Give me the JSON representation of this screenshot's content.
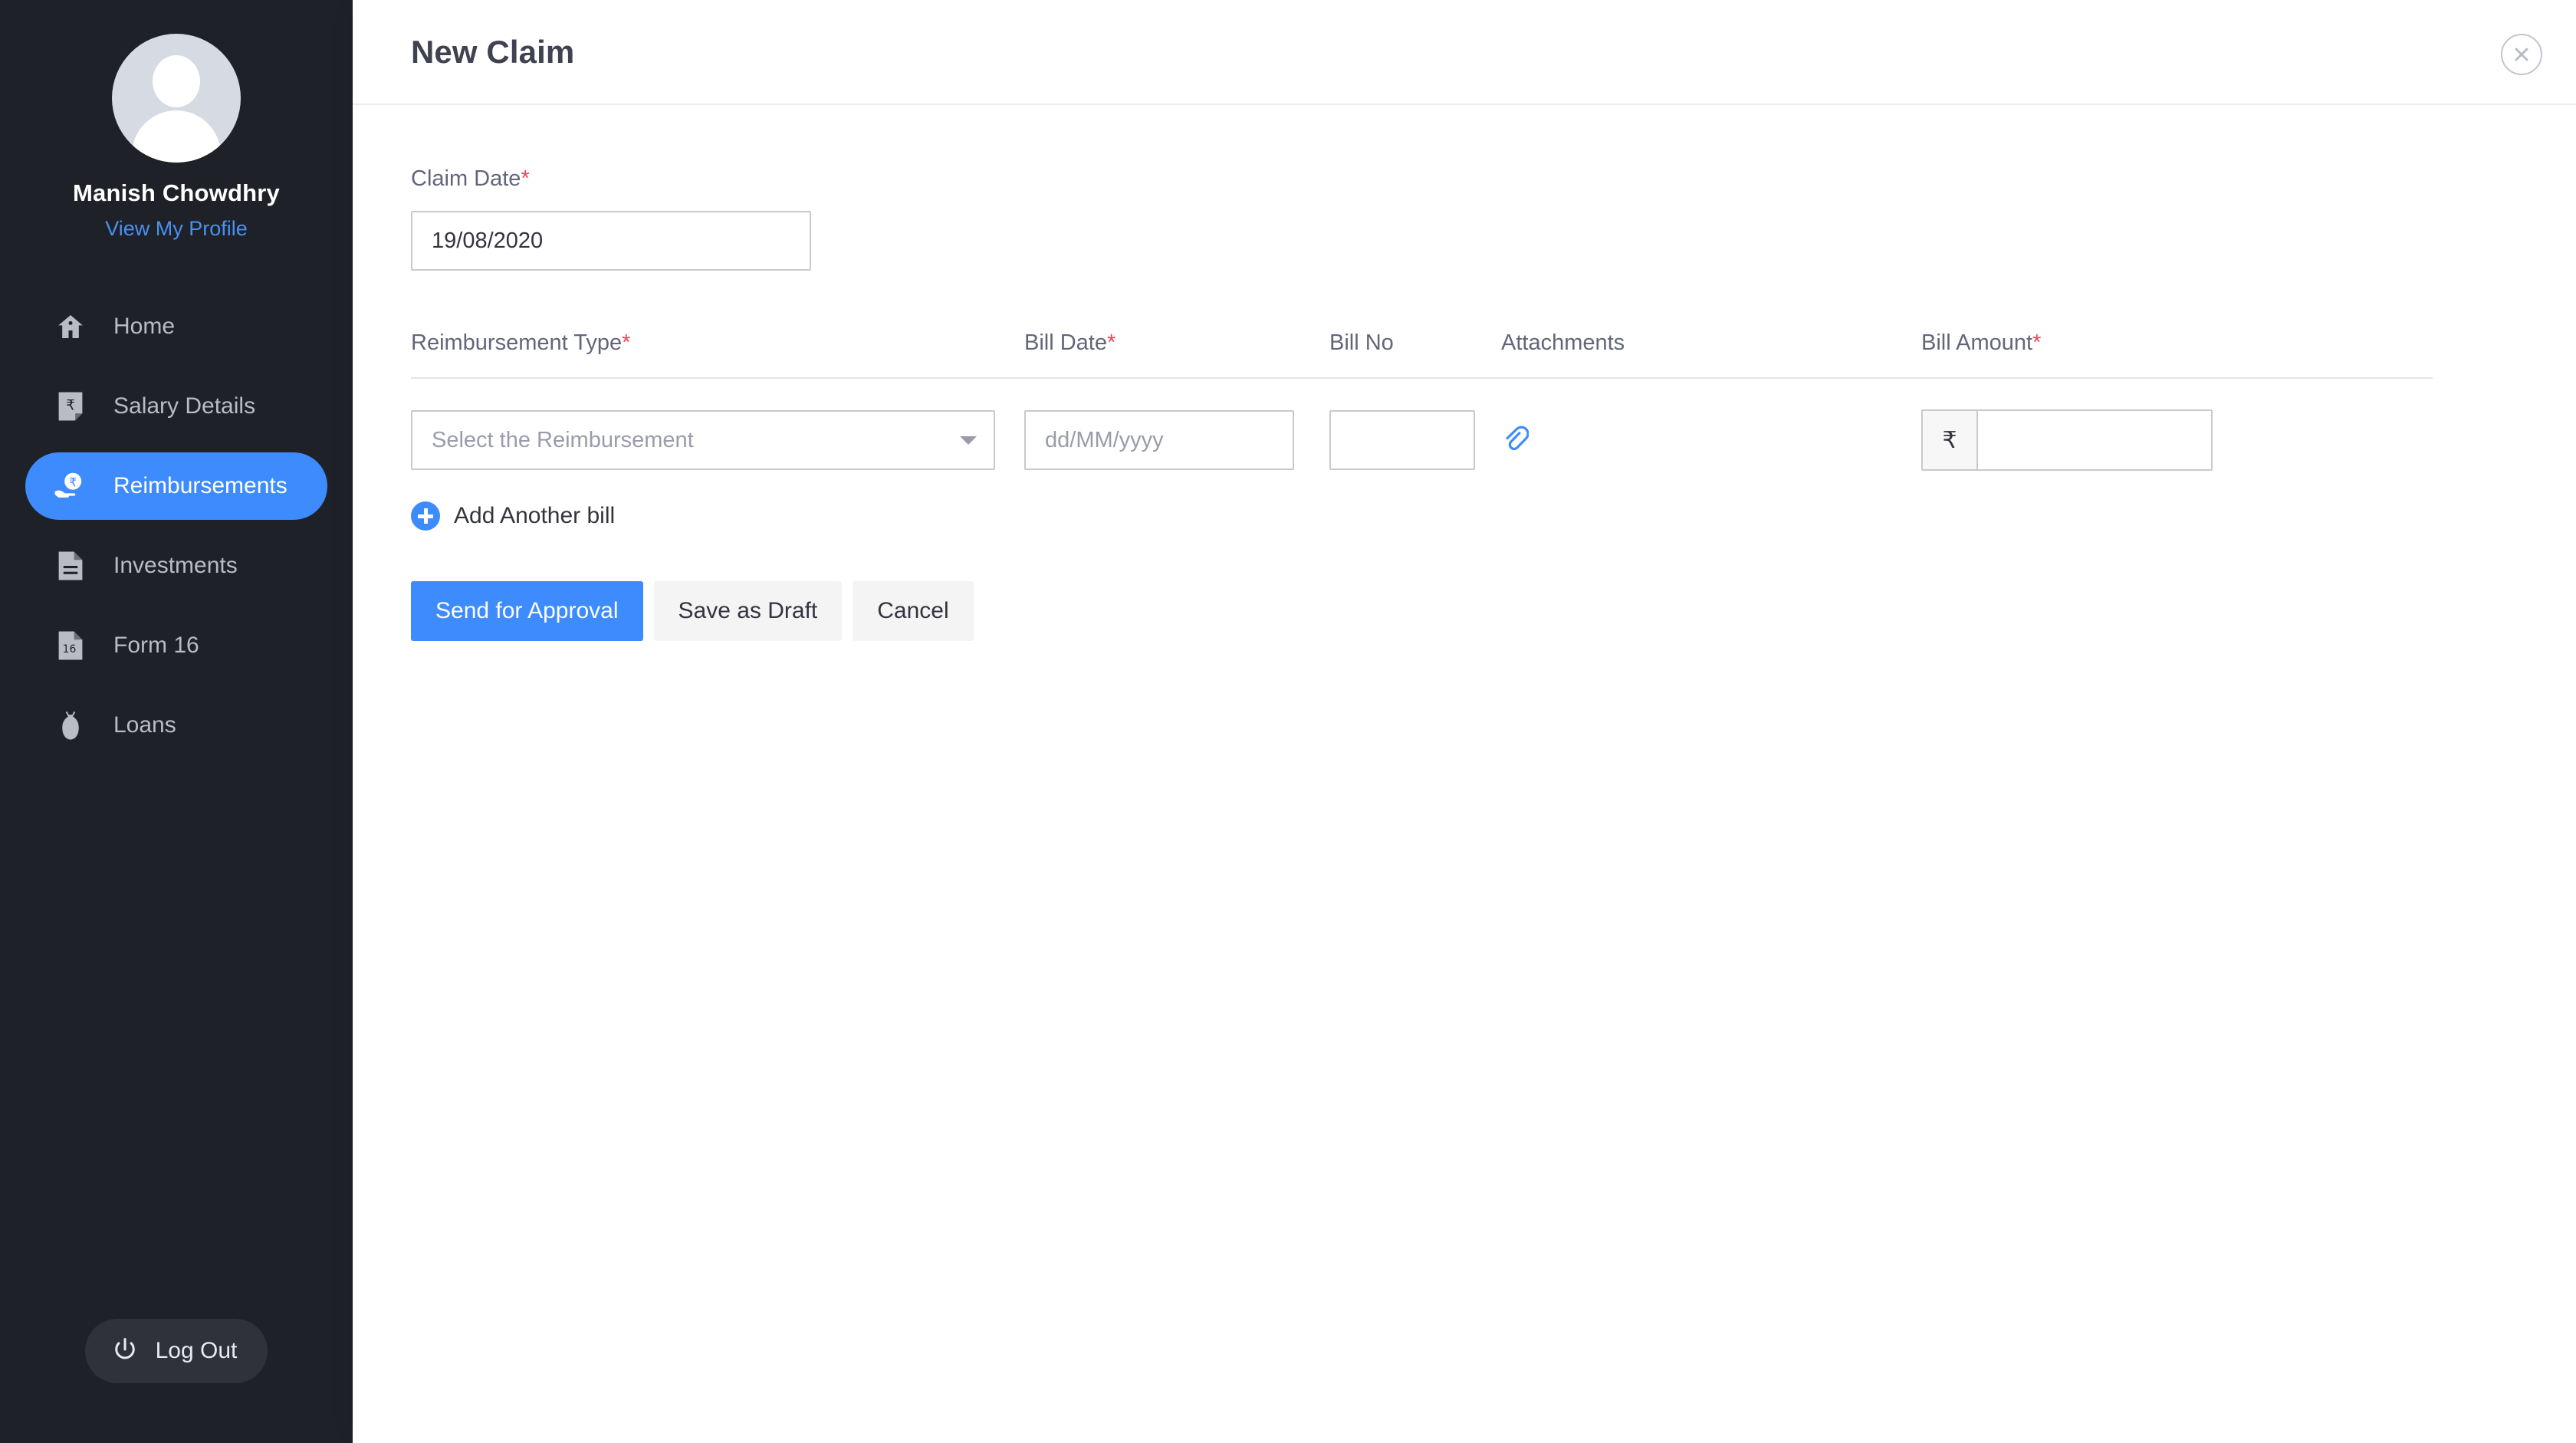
{
  "colors": {
    "sidebar_bg": "#1f2128",
    "accent": "#3d8bfd",
    "link": "#4a90f0",
    "required": "#ef4056",
    "text_dark": "#32353f",
    "text_muted": "#62667a",
    "placeholder": "#9a9cab",
    "border": "#c8cacf"
  },
  "sidebar": {
    "user_name": "Manish Chowdhry",
    "profile_link": "View My Profile",
    "avatar_icon": "user-avatar-placeholder-icon",
    "items": [
      {
        "label": "Home",
        "icon": "home-icon",
        "active": false
      },
      {
        "label": "Salary Details",
        "icon": "rupee-document-icon",
        "active": false
      },
      {
        "label": "Reimbursements",
        "icon": "hand-rupee-coin-icon",
        "active": true
      },
      {
        "label": "Investments",
        "icon": "document-lines-icon",
        "active": false
      },
      {
        "label": "Form 16",
        "icon": "document-16-icon",
        "active": false
      },
      {
        "label": "Loans",
        "icon": "money-bag-icon",
        "active": false
      }
    ],
    "logout": {
      "label": "Log Out",
      "icon": "power-icon"
    }
  },
  "header": {
    "title": "New Claim",
    "close_icon": "close-icon"
  },
  "form": {
    "claim_date": {
      "label": "Claim Date",
      "required_marker": "*",
      "value": "19/08/2020"
    },
    "table": {
      "columns": [
        {
          "label": "Reimbursement Type",
          "required_marker": "*"
        },
        {
          "label": "Bill Date",
          "required_marker": "*"
        },
        {
          "label": "Bill No",
          "required_marker": ""
        },
        {
          "label": "Attachments",
          "required_marker": ""
        },
        {
          "label": "Bill Amount",
          "required_marker": "*"
        }
      ],
      "rows": [
        {
          "reimbursement_type": {
            "value": "",
            "placeholder": "Select the Reimbursement",
            "dropdown_icon": "chevron-down-icon"
          },
          "bill_date": {
            "value": "",
            "placeholder": "dd/MM/yyyy"
          },
          "bill_no": {
            "value": "",
            "placeholder": ""
          },
          "attachment": {
            "icon": "paperclip-icon"
          },
          "bill_amount": {
            "currency_symbol": "₹",
            "value": "",
            "placeholder": ""
          }
        }
      ]
    },
    "add_another_bill": {
      "label": "Add Another bill",
      "icon": "plus-circle-icon"
    },
    "buttons": [
      {
        "label": "Send for Approval",
        "style": "primary"
      },
      {
        "label": "Save as Draft",
        "style": "secondary"
      },
      {
        "label": "Cancel",
        "style": "secondary"
      }
    ]
  }
}
